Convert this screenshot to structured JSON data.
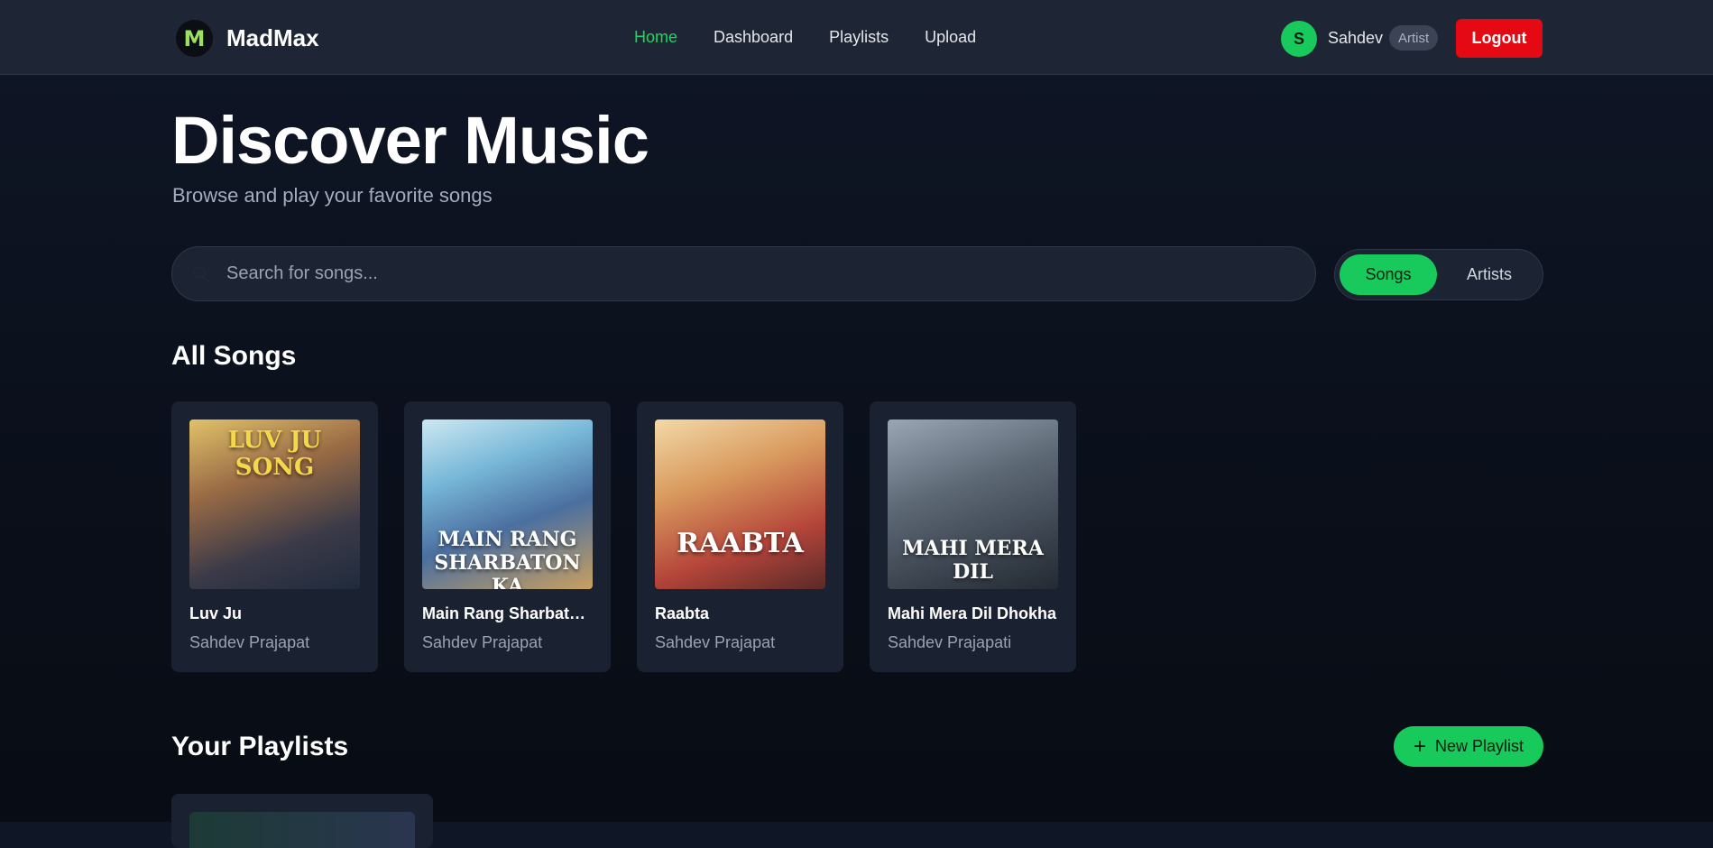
{
  "brand": {
    "logo_letter": "M",
    "name": "MadMax"
  },
  "nav": {
    "items": [
      {
        "label": "Home",
        "active": true
      },
      {
        "label": "Dashboard",
        "active": false
      },
      {
        "label": "Playlists",
        "active": false
      },
      {
        "label": "Upload",
        "active": false
      }
    ]
  },
  "user": {
    "initial": "S",
    "name": "Sahdev",
    "role": "Artist",
    "logout_label": "Logout"
  },
  "hero": {
    "title": "Discover Music",
    "subtitle": "Browse and play your favorite songs"
  },
  "search": {
    "placeholder": "Search for songs...",
    "value": "",
    "icon": "search-icon"
  },
  "toggle": {
    "songs_label": "Songs",
    "artists_label": "Artists",
    "selected": "Songs"
  },
  "all_songs": {
    "heading": "All Songs",
    "songs": [
      {
        "title": "Luv Ju",
        "artist": "Sahdev Prajapat",
        "cover_text": "LUV JU SONG"
      },
      {
        "title": "Main Rang Sharbaton...",
        "artist": "Sahdev Prajapat",
        "cover_text": "MAIN RANG SHARBATON KA"
      },
      {
        "title": "Raabta",
        "artist": "Sahdev Prajapat",
        "cover_text": "RAABTA"
      },
      {
        "title": "Mahi Mera Dil Dhokha",
        "artist": "Sahdev Prajapati",
        "cover_text": "MAHI MERA DIL"
      }
    ]
  },
  "playlists": {
    "heading": "Your Playlists",
    "new_label": "New Playlist"
  },
  "colors": {
    "accent": "#18c95c",
    "active_nav": "#1ed760",
    "logout": "#e50914",
    "card": "#1a2130"
  }
}
